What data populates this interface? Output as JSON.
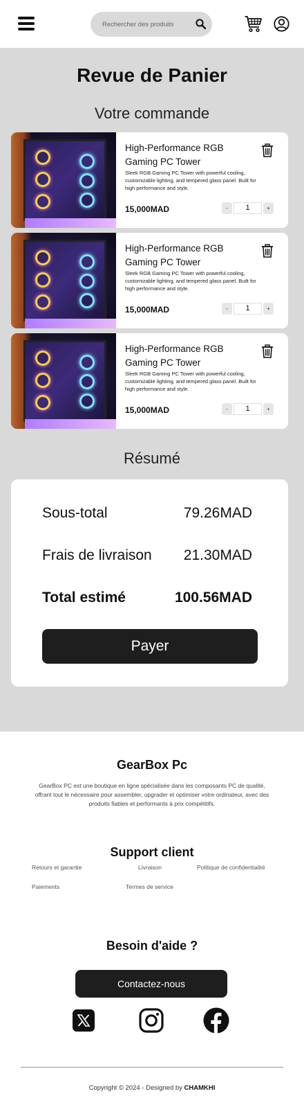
{
  "header": {
    "search_placeholder": "Rechercher des produits",
    "icons": [
      "menu-icon",
      "search-icon",
      "cart-icon",
      "user-icon"
    ]
  },
  "main": {
    "title": "Revue de Panier",
    "order_heading": "Votre commande",
    "items": [
      {
        "title": "High-Performance RGB Gaming PC Tower",
        "description": "Sleek RGB Gaming PC Tower with powerful cooling, customizable lighting, and tempered glass panel. Built for high performance and style.",
        "price": "15,000MAD",
        "quantity": "1",
        "minus": "-",
        "plus": "+"
      },
      {
        "title": "High-Performance RGB Gaming PC Tower",
        "description": "Sleek RGB Gaming PC Tower with powerful cooling, customizable lighting, and tempered glass panel. Built for high performance and style.",
        "price": "15,000MAD",
        "quantity": "1",
        "minus": "-",
        "plus": "+"
      },
      {
        "title": "High-Performance RGB Gaming PC Tower",
        "description": "Sleek RGB Gaming PC Tower with powerful cooling, customizable lighting, and tempered glass panel. Built for high performance and style.",
        "price": "15,000MAD",
        "quantity": "1",
        "minus": "-",
        "plus": "+"
      }
    ],
    "summary_heading": "Résumé",
    "summary": {
      "subtotal_label": "Sous-total",
      "subtotal_value": "79.26MAD",
      "shipping_label": "Frais de livraison",
      "shipping_value": "21.30MAD",
      "total_label": "Total estimé",
      "total_value": "100.56MAD",
      "pay_label": "Payer"
    }
  },
  "footer": {
    "brand": "GearBox Pc",
    "about": "GearBox PC est une boutique en ligne spécialisée dans les composants PC de qualité, offrant tout le nécessaire pour assembler, upgrader et optimiser votre ordinateur, avec des produits fiables et performants à prix compétitifs.",
    "support_title": "Support client",
    "links": {
      "returns": "Retours et garantie",
      "delivery": "Livraison",
      "privacy": "Politique de confidentialité",
      "payments": "Paiements",
      "terms": "Termes de service"
    },
    "help_title": "Besoin d'aide ?",
    "contact_label": "Contactez-nous",
    "social_icons": [
      "x-icon",
      "instagram-icon",
      "facebook-icon"
    ],
    "copyright_prefix": "Copyright © 2024 - Designed by ",
    "copyright_author": "CHAMKHI"
  },
  "colors": {
    "background_main": "#d9d9d9",
    "card": "#ffffff",
    "button_dark": "#1e1e1e",
    "text": "#111111"
  }
}
